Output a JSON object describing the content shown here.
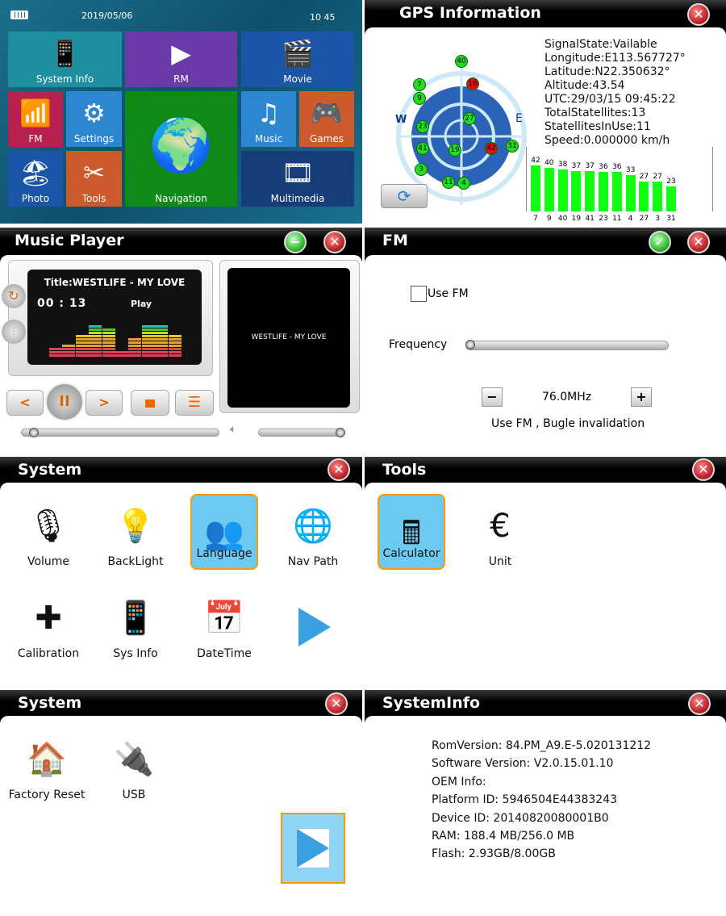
{
  "launcher": {
    "date": "2019/05/06",
    "time": "10 45",
    "battery_icon": "battery-full-icon",
    "tiles": [
      {
        "label": "System Info",
        "icon": "map-phone-icon",
        "color": "#1e8fa0"
      },
      {
        "label": "RM",
        "icon": "play-circle-icon",
        "color": "#6a3aa8"
      },
      {
        "label": "Movie",
        "icon": "clapperboard-icon",
        "color": "#1b55a8"
      },
      {
        "label": "FM",
        "icon": "wifi-signal-icon",
        "color": "#b8204f"
      },
      {
        "label": "Settings",
        "icon": "gear-icon",
        "color": "#2d86d0"
      },
      {
        "label": "Navigation",
        "icon": "globe-icon",
        "color": "#0f8a19"
      },
      {
        "label": "Music",
        "icon": "music-note-icon",
        "color": "#2d86d0"
      },
      {
        "label": "Games",
        "icon": "gamepad-icon",
        "color": "#cc5a2c"
      },
      {
        "label": "Photo",
        "icon": "beach-photo-icon",
        "color": "#1b55a8"
      },
      {
        "label": "Tools",
        "icon": "wrench-screwdriver-icon",
        "color": "#cc5a2c"
      },
      {
        "label": "Multimedia",
        "icon": "multimedia-icon",
        "color": "#173d78"
      }
    ]
  },
  "gps": {
    "title": "GPS Information",
    "compass_w": "W",
    "compass_e": "E",
    "lines": [
      "SignalState:Vailable",
      "Longitude:E113.567727°",
      "Latitude:N22.350632°",
      "Altitude:43.54",
      "UTC:29/03/15 09:45:22",
      "TotalStatellites:13",
      "StatellitesInUse:11",
      "Speed:0.000000 km/h"
    ],
    "satellites": [
      {
        "id": "40",
        "in_use": true
      },
      {
        "id": "16",
        "in_use": false
      },
      {
        "id": "7",
        "in_use": true
      },
      {
        "id": "9",
        "in_use": true
      },
      {
        "id": "27",
        "in_use": true
      },
      {
        "id": "23",
        "in_use": true
      },
      {
        "id": "31",
        "in_use": true
      },
      {
        "id": "41",
        "in_use": true
      },
      {
        "id": "19",
        "in_use": true
      },
      {
        "id": "42",
        "in_use": false
      },
      {
        "id": "3",
        "in_use": true
      },
      {
        "id": "11",
        "in_use": true
      },
      {
        "id": "4",
        "in_use": true
      }
    ],
    "chart_data": {
      "type": "bar",
      "categories": [
        "7",
        "9",
        "40",
        "19",
        "41",
        "23",
        "11",
        "4",
        "27",
        "3",
        "31"
      ],
      "values": [
        42,
        40,
        38,
        37,
        37,
        36,
        36,
        33,
        27,
        27,
        23
      ],
      "ylim": [
        0,
        50
      ]
    },
    "colors": {
      "in_use": "#22dd22",
      "not_in_use": "#dd1111"
    }
  },
  "music": {
    "title": "Music Player",
    "track_title": "Title:WESTLIFE - MY LOVE",
    "time": "00 : 13",
    "state": "Play",
    "cover_text": "WESTLIFE - MY LOVE",
    "eq_levels": [
      3,
      4,
      7,
      10,
      9,
      2,
      6,
      10,
      10,
      7
    ],
    "progress": 0.06,
    "volume": 0.95
  },
  "fm": {
    "title": "FM",
    "use_fm_label": "Use FM",
    "use_fm_checked": false,
    "frequency_label": "Frequency",
    "frequency": "76.0MHz",
    "frequency_position": 0.02,
    "minus": "−",
    "plus": "+",
    "status": "Use FM , Bugle invalidation"
  },
  "system1": {
    "title": "System",
    "items": [
      {
        "label": "Volume",
        "icon": "microphone-icon",
        "selected": false
      },
      {
        "label": "BackLight",
        "icon": "backlight-icon",
        "selected": false
      },
      {
        "label": "Language",
        "icon": "people-icon",
        "selected": true
      },
      {
        "label": "Nav Path",
        "icon": "globe-arrow-icon",
        "selected": false
      },
      {
        "label": "Calibration",
        "icon": "calibration-icon",
        "selected": false
      },
      {
        "label": "Sys Info",
        "icon": "map-phone-icon",
        "selected": false
      },
      {
        "label": "DateTime",
        "icon": "calendar-clock-icon",
        "selected": false
      }
    ],
    "next_icon": "next-arrow-icon"
  },
  "tools": {
    "title": "Tools",
    "items": [
      {
        "label": "Calculator",
        "icon": "calculator-icon",
        "selected": true
      },
      {
        "label": "Unit",
        "icon": "currency-icon",
        "selected": false
      }
    ]
  },
  "system2": {
    "title": "System",
    "items": [
      {
        "label": "Factory Reset",
        "icon": "house-icon"
      },
      {
        "label": "USB",
        "icon": "usb-drive-icon"
      }
    ],
    "next_icon": "next-arrow-icon"
  },
  "sysinfo": {
    "title": "SystemInfo",
    "lines": [
      "RomVersion: 84.PM_A9.E-5.020131212",
      "Software Version: V2.0.15.01.10",
      "OEM Info:",
      "Platform ID: 5946504E44383243",
      "Device ID: 20140820080001B0",
      "RAM: 188.4 MB/256.0 MB",
      "Flash: 2.93GB/8.00GB"
    ]
  }
}
